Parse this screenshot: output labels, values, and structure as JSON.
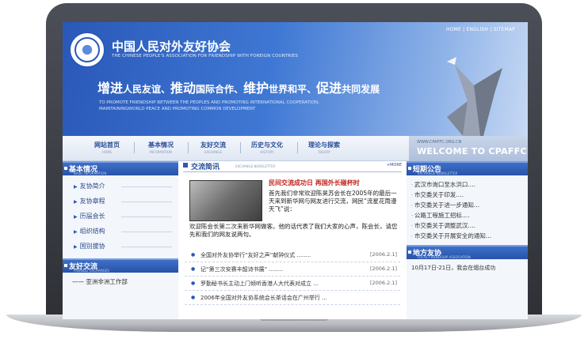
{
  "header": {
    "toplinks": "HOME | ENGLISH | SITEMAP",
    "org_cn": "中国人民对外友好协会",
    "org_en": "THE CHINESE PEOPLE'S ASSOCIATION FOR FRIENDSHIP WITH FOREIGN COUNTRIES",
    "slogan_parts": [
      "增进",
      "人民友谊、",
      "推动",
      "国际合作、",
      "维护",
      "世界和平、",
      "促进",
      "共同发展"
    ],
    "slogan_en": "TO PROMOTE FRIENDSHIP BETWEEN THE PEOPLES AND PROMOTING INTERNATIONAL COOPERATION, MAINTAININGWORLD PEACE AND PROMOTING COMMON DEVELOPMENT"
  },
  "nav": {
    "items": [
      {
        "cn": "网站首页",
        "en": "HOME"
      },
      {
        "cn": "基本情况",
        "en": "INFORMATION"
      },
      {
        "cn": "友好交流",
        "en": "EXCHANGE"
      },
      {
        "cn": "历史与文化",
        "en": "HISTORY"
      },
      {
        "cn": "理论与探索",
        "en": "THEORY"
      }
    ],
    "welcome_url": "WWW.CPAFFC.ORG.CN",
    "welcome_text": "WELCOME TO CPAFFC"
  },
  "left": {
    "sec1_cn": "基本情况",
    "sec1_en": "BASIC INFORMATION",
    "items": [
      "友协简介",
      "友协章程",
      "历届会长",
      "组织结构",
      "国别拔协"
    ],
    "sec2_cn": "友好交流",
    "sec2_en": "FRIENDLY EXCHANGES",
    "sec2_text": "——  亚洲非洲工作部"
  },
  "center": {
    "head_cn": "交流简讯",
    "head_en": "EXCHANGE NEWSLETTER",
    "more": "+MORE",
    "feat_title": "民间交流成功日  再国外长碰杯时",
    "feat_body": "首先我们非常欢迎陈昊苏会长在2005年的最后一天来到新华网与网友进行交流，网民“流星花雨漫天飞”说：",
    "feat_body2": "欢迎陈会长第二次来新华网做客。他的话代表了我们大家的心声，陈会长，请您先和我们的网友说两句。",
    "news": [
      {
        "title": "全国对外友协举行“友好之声”献钟仪式 ........",
        "date": "[2006.2.1]"
      },
      {
        "title": "记“第三次安赛丰韶诗书展” ........",
        "date": "[2006.2.1]"
      },
      {
        "title": "罗勤秘书长主动上门倾听香港人大代表对成立 ...",
        "date": "[2006.2.1]"
      },
      {
        "title": "2006年全国对外友协系统会长茶话会在广州举行 ...",
        "date": ""
      }
    ]
  },
  "right": {
    "sec1_cn": "短期公告",
    "sec1_en": "EXCHANGE NEWSLETTER",
    "items": [
      "武汉市询口至水洪口....",
      "市交委关于印发....",
      "市交委关于进一步通知...",
      "公路工程施工招标....",
      "市交委关于调整武汉....",
      "市交委关于开展安全的通知..."
    ],
    "sec2_cn": "地方友协",
    "sec2_en": "LOCAL FRIENDSHIP ASSOCIATION",
    "sec2_text": "10月17日-21日，我会在烟台成功"
  }
}
